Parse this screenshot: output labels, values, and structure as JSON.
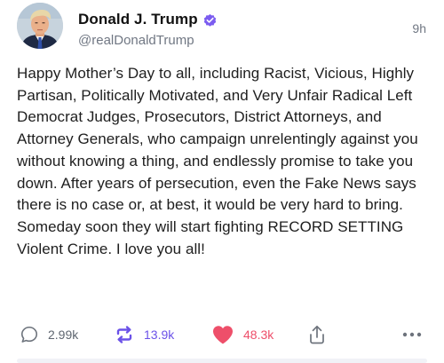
{
  "post": {
    "author": {
      "display_name": "Donald J. Trump",
      "handle": "@realDonaldTrump",
      "verified": true,
      "verified_color": "#7b5cf0",
      "avatar_icon": "profile-photo"
    },
    "timestamp": "9h",
    "text": "Happy Mother’s Day to all, including Racist, Vicious, Highly Partisan, Politically Motivated, and Very Unfair Radical Left Democrat Judges, Prosecutors, District Attorneys, and Attorney Generals, who campaign unrelentingly against you without knowing a thing, and endlessly promise to take you down. After years of persecution, even the Fake News says there is no case or, at best, it would be very hard to bring. Someday soon they will start fighting RECORD SETTING Violent Crime. I love you all!",
    "actions": {
      "reply": {
        "icon": "reply-icon",
        "count": "2.99k"
      },
      "retruth": {
        "icon": "retruth-icon",
        "count": "13.9k",
        "color": "#6b52e8"
      },
      "like": {
        "icon": "heart-icon",
        "count": "48.3k",
        "color": "#ee4f6a"
      },
      "share": {
        "icon": "share-icon"
      },
      "more": {
        "icon": "more-icon"
      }
    }
  }
}
